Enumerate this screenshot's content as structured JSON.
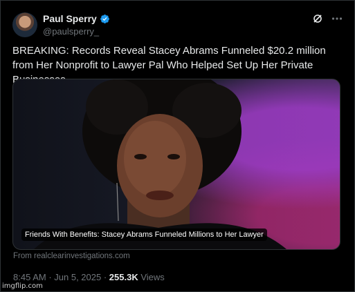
{
  "author": {
    "name": "Paul Sperry",
    "handle": "@paulsperry_",
    "verified": true
  },
  "icons": [
    "verified-badge-icon",
    "grok-icon",
    "more-icon"
  ],
  "tweet": {
    "text": "BREAKING: Records Reveal Stacey Abrams Funneled $20.2 million from Her Nonprofit to Lawyer Pal Who Helped Set Up Her Private Businesses"
  },
  "card": {
    "caption": "Friends With Benefits: Stacey Abrams Funneled Millions to Her Lawyer",
    "source": "From realclearinvestigations.com"
  },
  "meta": {
    "time": "8:45 AM",
    "date": "Jun 5, 2025",
    "separator": " · ",
    "views_count": "255.3K",
    "views_label": " Views"
  },
  "watermark": "imgflip.com",
  "colors": {
    "background": "#000000",
    "text": "#e7e9ea",
    "muted": "#71767b",
    "verified": "#1d9bf0",
    "border": "#2f3336"
  }
}
